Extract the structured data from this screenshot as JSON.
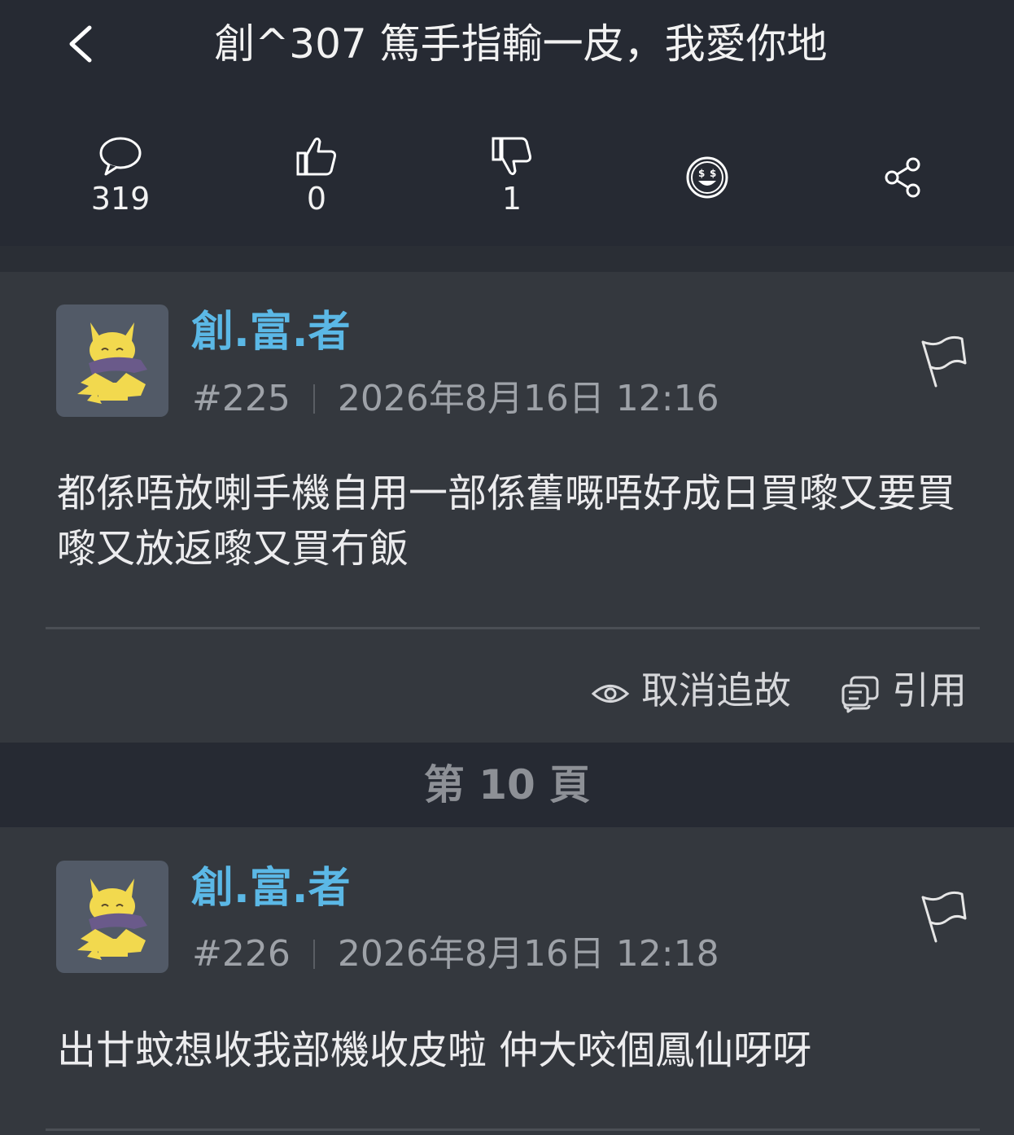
{
  "header": {
    "title": "創^307 篤手指輸一皮，我愛你地",
    "stats": {
      "comments": "319",
      "likes": "0",
      "dislikes": "1"
    }
  },
  "posts": [
    {
      "username": "創.富.者",
      "number": "#225",
      "timestamp": "2026年8月16日 12:16",
      "body": "都係唔放喇手機自用一部係舊嘅唔好成日買嚟又要買嚟又放返嚟又買冇飯",
      "actions": {
        "unfollow_label": "取消追故",
        "quote_label": "引用"
      }
    },
    {
      "username": "創.富.者",
      "number": "#226",
      "timestamp": "2026年8月16日 12:18",
      "body": "出廿蚊想收我部機收皮啦 仲大咬個鳳仙呀呀"
    }
  ],
  "page_separator": "第 10 頁",
  "colors": {
    "header_bg": "#262a33",
    "content_bg": "#34383e",
    "username": "#5bb8e6",
    "meta": "#9ea2a8",
    "avatar_bg": "#525a67",
    "avatar_pokemon": "#f2d94e"
  },
  "icons": [
    "back-arrow-icon",
    "comment-icon",
    "thumbs-up-icon",
    "thumbs-down-icon",
    "emoji-icon",
    "share-icon",
    "flag-icon",
    "eye-icon",
    "quote-icon"
  ]
}
